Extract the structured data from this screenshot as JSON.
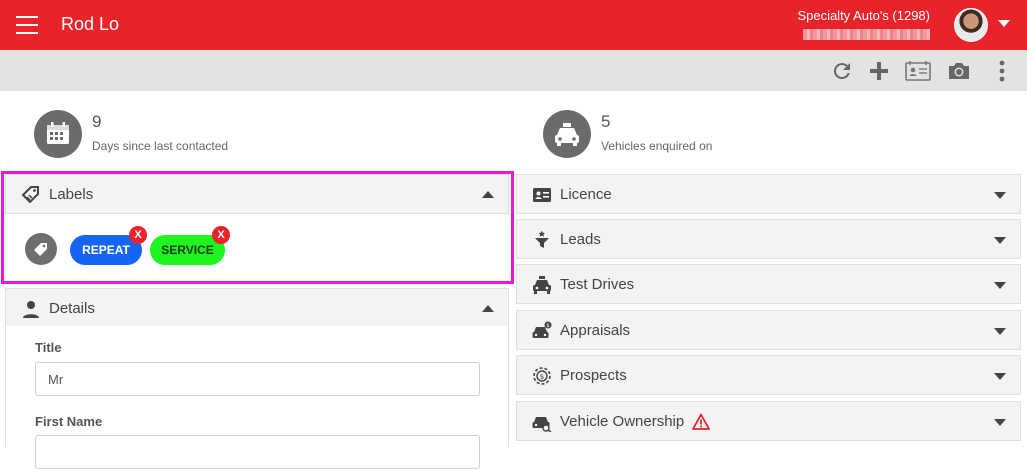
{
  "header": {
    "title": "Rod Lo",
    "dealer": "Specialty Auto's (1298)"
  },
  "toolbar": {
    "icons": [
      "refresh-icon",
      "plus-icon",
      "contact-card-icon",
      "camera-icon",
      "more-vert-icon"
    ]
  },
  "stats": {
    "days": {
      "value": "9",
      "label": "Days since last contacted"
    },
    "vehicles": {
      "value": "5",
      "label": "Vehicles enquired on"
    }
  },
  "labels_panel": {
    "title": "Labels",
    "chips": [
      {
        "text": "REPEAT",
        "bg": "#1565f5",
        "fg": "#ffffff"
      },
      {
        "text": "SERVICE",
        "bg": "#1ef51e",
        "fg": "#1a3a1a"
      }
    ],
    "remove_glyph": "X"
  },
  "details_panel": {
    "title": "Details",
    "fields": [
      {
        "label": "Title",
        "value": "Mr"
      },
      {
        "label": "First Name",
        "value": ""
      }
    ]
  },
  "right_panels": [
    {
      "title": "Licence"
    },
    {
      "title": "Leads"
    },
    {
      "title": "Test Drives"
    },
    {
      "title": "Appraisals"
    },
    {
      "title": "Prospects"
    },
    {
      "title": "Vehicle Ownership",
      "warning": true
    }
  ],
  "colors": {
    "brand_red": "#e8232a",
    "highlight": "#e31bd7"
  }
}
